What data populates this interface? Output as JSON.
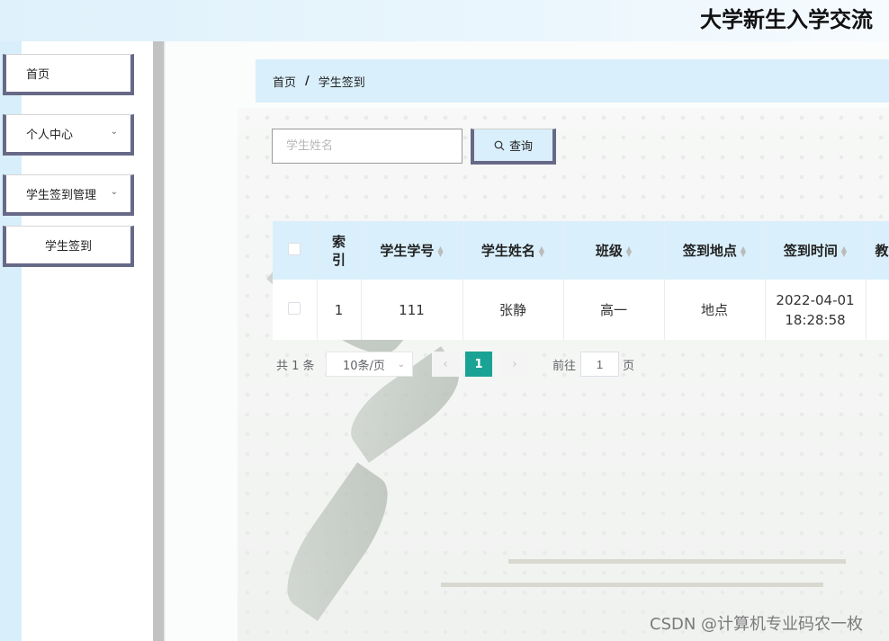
{
  "header": {
    "title": "大学新生入学交流"
  },
  "sidebar": {
    "items": [
      {
        "label": "首页"
      },
      {
        "label": "个人中心"
      },
      {
        "label": "学生签到管理"
      },
      {
        "label": "学生签到"
      }
    ]
  },
  "breadcrumb": {
    "home": "首页",
    "separator": "/",
    "current": "学生签到"
  },
  "search": {
    "placeholder": "学生姓名",
    "button_label": "查询"
  },
  "table": {
    "headers": [
      "索引",
      "学生学号",
      "学生姓名",
      "班级",
      "签到地点",
      "签到时间",
      "教"
    ],
    "rows": [
      {
        "index": "1",
        "student_no": "111",
        "name": "张静",
        "class": "高一",
        "location": "地点",
        "date": "2022-04-01",
        "time": "18:28:58"
      }
    ]
  },
  "pagination": {
    "total": "共 1 条",
    "page_size": "10条/页",
    "current_page": "1",
    "goto_prefix": "前往",
    "goto_value": "1",
    "goto_suffix": "页"
  },
  "watermark": "CSDN @计算机专业码农一枚",
  "colors": {
    "accent": "#1aa394",
    "header_bg": "#d9effb",
    "border_accent": "#676986"
  }
}
